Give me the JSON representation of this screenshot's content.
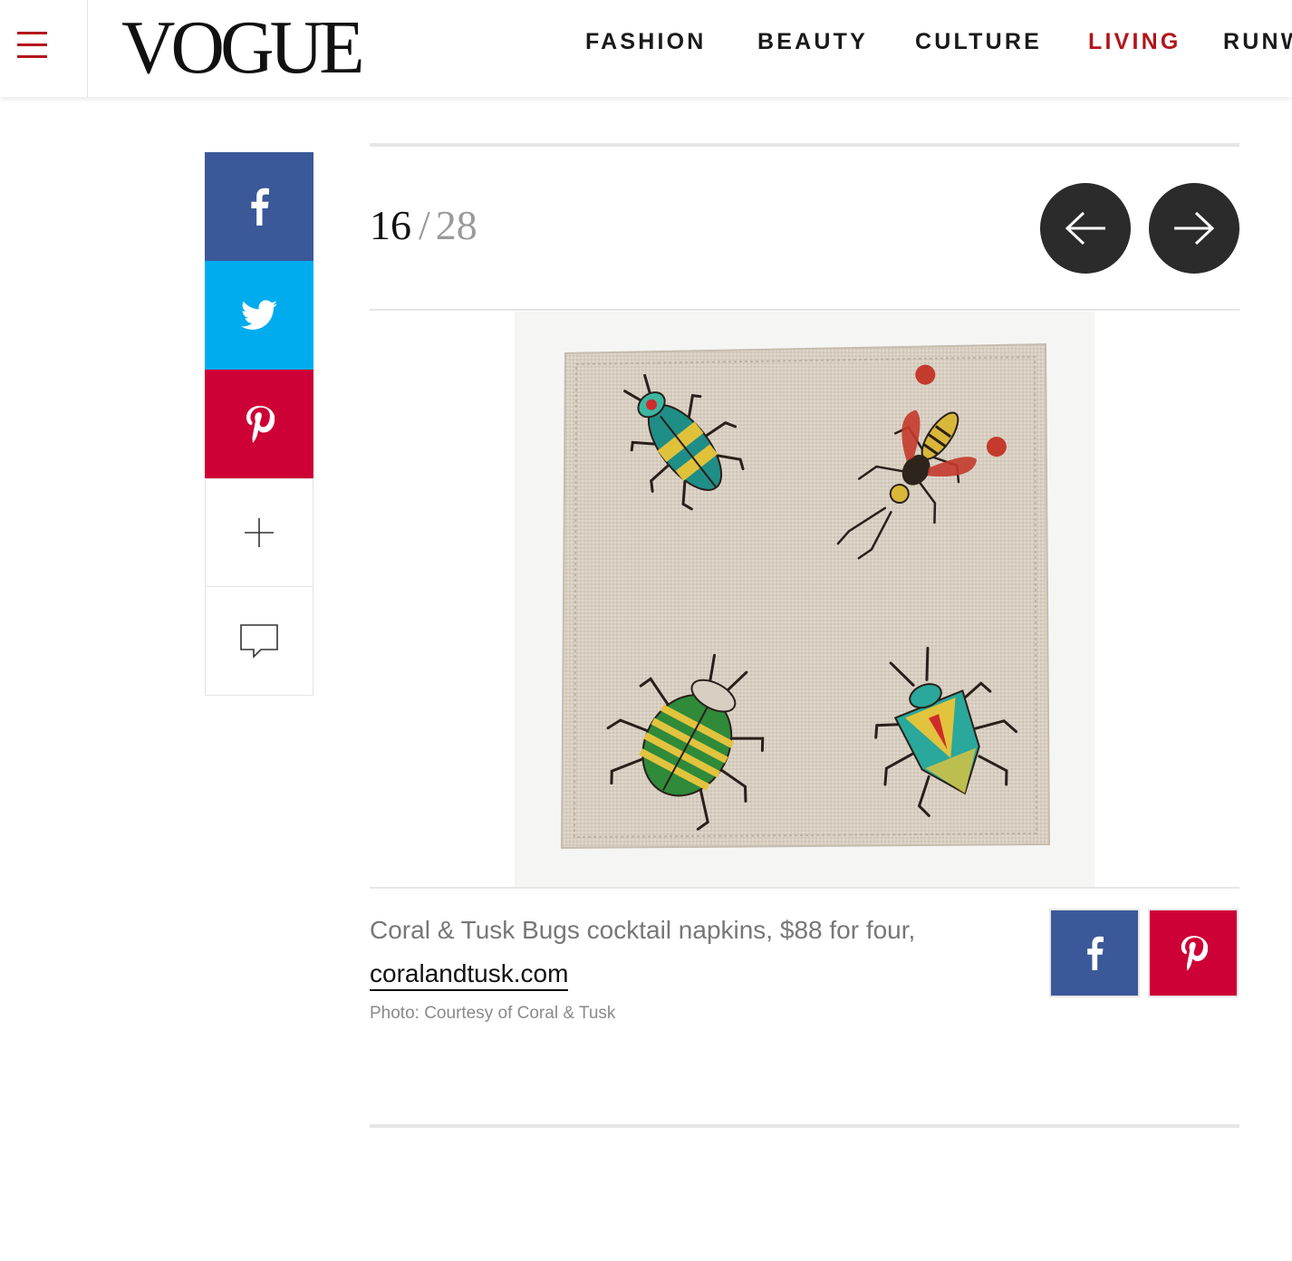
{
  "header": {
    "logo": "VOGUE",
    "nav": [
      {
        "label": "FASHION",
        "active": false
      },
      {
        "label": "BEAUTY",
        "active": false
      },
      {
        "label": "CULTURE",
        "active": false
      },
      {
        "label": "LIVING",
        "active": true
      },
      {
        "label": "RUNWAY",
        "active": false
      }
    ]
  },
  "share_rail": {
    "items": [
      "facebook-icon",
      "twitter-icon",
      "pinterest-icon",
      "plus-icon",
      "comment-icon"
    ]
  },
  "slideshow": {
    "current": "16",
    "separator": "/",
    "total": "28"
  },
  "caption": {
    "text": "Coral & Tusk Bugs cocktail napkins, $88 for four,",
    "link_text": "coralandtusk.com",
    "credit": "Photo: Courtesy of Coral & Tusk"
  },
  "colors": {
    "accent": "#b3151b",
    "facebook": "#3b5998",
    "twitter": "#00acee",
    "pinterest": "#cd0136",
    "arrow_button": "#2b2b2b"
  }
}
